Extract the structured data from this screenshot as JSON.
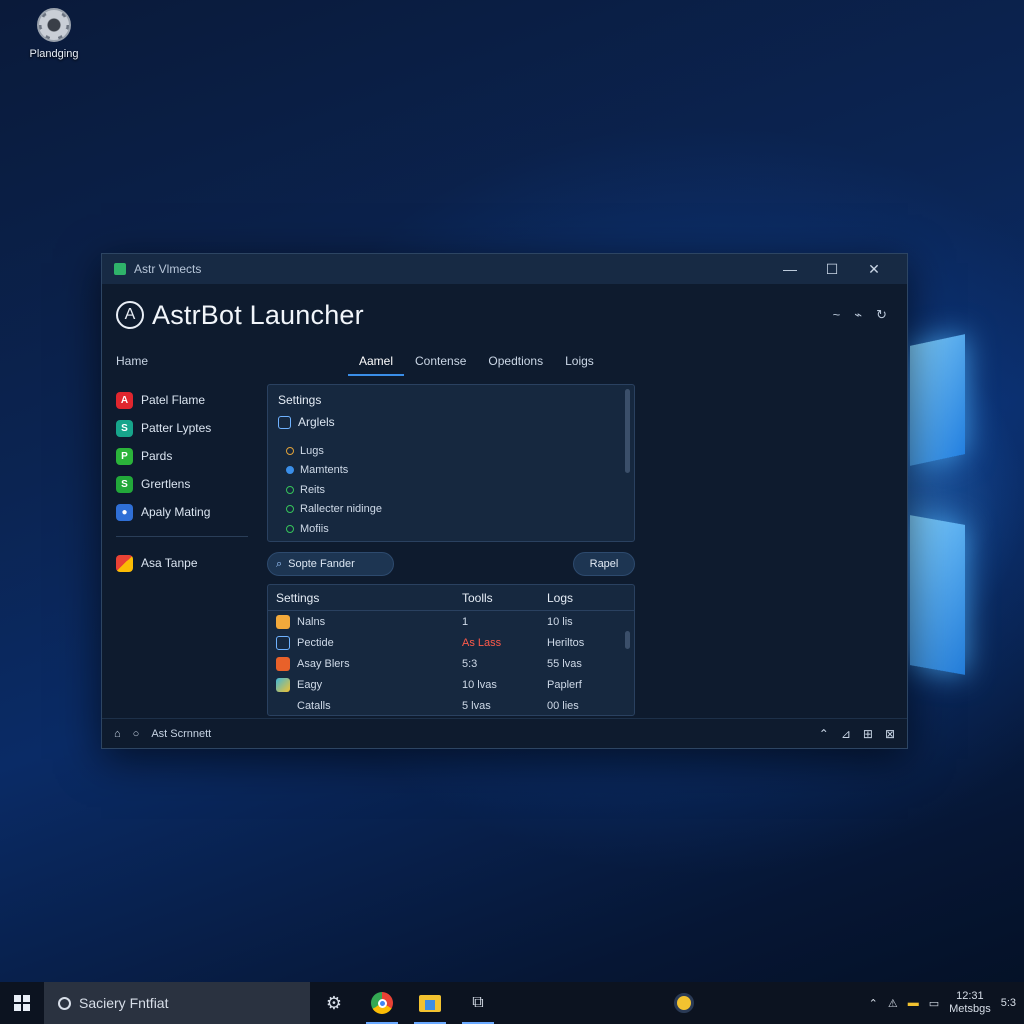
{
  "desktop": {
    "icon_label": "Plandging"
  },
  "window": {
    "titlebar_title": "Astr Vlmects",
    "controls": {
      "minimize": "—",
      "maximize": "☐",
      "close": "✕"
    },
    "app_title": "AstrBot Launcher",
    "header_icons": [
      "~",
      "⌁",
      "↻"
    ]
  },
  "sidebar": {
    "home": "Hame",
    "items": [
      {
        "label": "Patel Flame",
        "icon": "red-app-icon",
        "color": "#e0262e"
      },
      {
        "label": "Patter Lyptes",
        "icon": "teal-app-icon",
        "color": "#17a58b"
      },
      {
        "label": "Pards",
        "icon": "green-app-icon",
        "color": "#2bb43a"
      },
      {
        "label": "Grertlens",
        "icon": "green-app-icon",
        "color": "#22a83a"
      },
      {
        "label": "Apaly Mating",
        "icon": "blue-app-icon",
        "color": "#2f6fd6"
      }
    ],
    "extra_item": {
      "label": "Asa Tanpe",
      "icon": "multicolor-app-icon"
    }
  },
  "tabs": [
    {
      "label": "Aamel",
      "active": true
    },
    {
      "label": "Contense",
      "active": false
    },
    {
      "label": "Opedtions",
      "active": false
    },
    {
      "label": "Loigs",
      "active": false
    }
  ],
  "settings_panel": {
    "title": "Settings",
    "section": "Arglels",
    "items": [
      {
        "label": "Lugs",
        "color": "#e0a23a"
      },
      {
        "label": "Mamtents",
        "color": "#3a8ee8"
      },
      {
        "label": "Reits",
        "color": "#36c45a"
      },
      {
        "label": "Rallecter nidinge",
        "color": "#36c45a"
      },
      {
        "label": "Mofiis",
        "color": "#36c45a"
      }
    ]
  },
  "search": {
    "label": "Sopte Fander"
  },
  "reset_button": "Rapel",
  "table": {
    "headers": [
      "Settings",
      "Toolls",
      "Logs"
    ],
    "rows": [
      {
        "name": "Nalns",
        "tools": "1",
        "logs": "10 lis",
        "icon_color": "#f2a93b"
      },
      {
        "name": "Pectide",
        "tools": "As Lass",
        "logs": "Heriltos",
        "icon_color": "#6fb2ff",
        "tools_alert": true
      },
      {
        "name": "Asay Blers",
        "tools": "5:3",
        "logs": "55 lvas",
        "icon_color": "#e8612a"
      },
      {
        "name": "Eagy",
        "tools": "10 lvas",
        "logs": "Paplerf",
        "icon_color": "#3fb6d8"
      },
      {
        "name": "Catalls",
        "tools": "5 lvas",
        "logs": "00 lies",
        "icon_color": ""
      }
    ]
  },
  "statusbar": {
    "text": "Ast Scrnnett",
    "right_icons": [
      "⌃",
      "⊿",
      "⊞",
      "⊠"
    ]
  },
  "taskbar": {
    "search_placeholder": "Saciery Fntfiat",
    "clock_time": "12:31",
    "clock_date": "Metsbgs",
    "tray_extra": "5:3"
  }
}
